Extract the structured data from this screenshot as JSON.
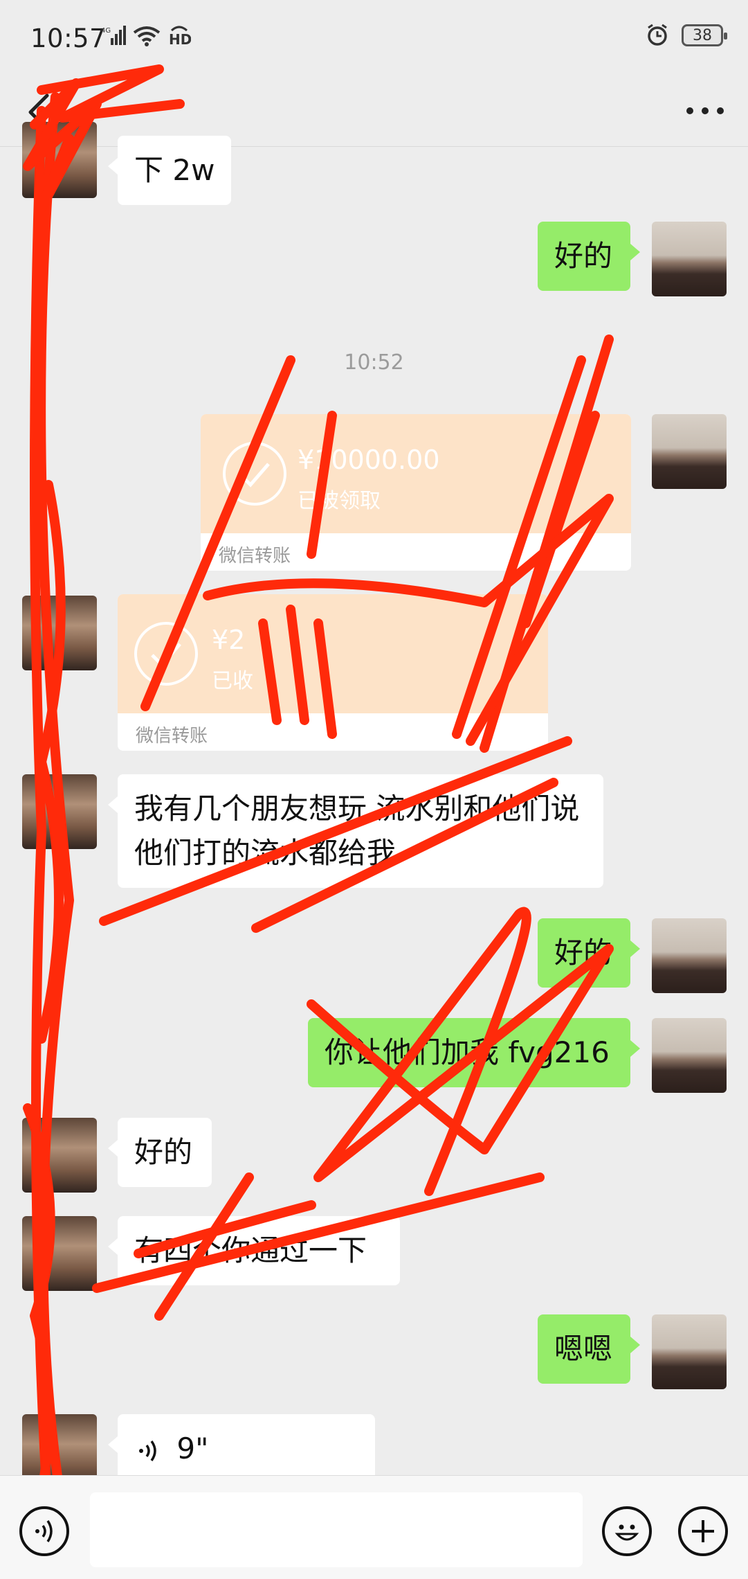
{
  "status_bar": {
    "time": "10:57",
    "network": "4G",
    "hd_label": "HD",
    "battery": "38"
  },
  "header": {
    "title": "一",
    "more_label": "···"
  },
  "messages": {
    "m1": {
      "sender": "them",
      "text": "下 2w"
    },
    "m2": {
      "sender": "me",
      "text": "好的"
    },
    "time1": "10:52",
    "m3": {
      "sender": "me",
      "type": "transfer",
      "amount": "¥10000.00",
      "status": "已被领取",
      "footer": "微信转账"
    },
    "m4": {
      "sender": "them",
      "type": "transfer",
      "amount": "¥2",
      "status": "已收",
      "footer": "微信转账"
    },
    "m5": {
      "sender": "them",
      "text": "我有几个朋友想玩  流水别和他们说  他们打的流水都给我"
    },
    "m6": {
      "sender": "me",
      "text": "好的"
    },
    "m7": {
      "sender": "me",
      "text": "你让他们加我 fvg216"
    },
    "m8": {
      "sender": "them",
      "text": "好的"
    },
    "m9": {
      "sender": "them",
      "text": "有四个你通过一下"
    },
    "m10": {
      "sender": "me",
      "text": "嗯嗯"
    },
    "m11": {
      "sender": "them",
      "type": "voice",
      "duration": "9\""
    }
  },
  "input": {
    "placeholder": ""
  },
  "colors": {
    "background": "#ededed",
    "out_bubble": "#95ec69",
    "in_bubble": "#ffffff",
    "transfer": "#fde3c8",
    "scribble": "#ff2a0a"
  },
  "icons": {
    "back": "chevron-left-icon",
    "more": "more-dots-icon",
    "voice": "voice-icon",
    "emoji": "emoji-icon",
    "plus": "plus-icon"
  }
}
